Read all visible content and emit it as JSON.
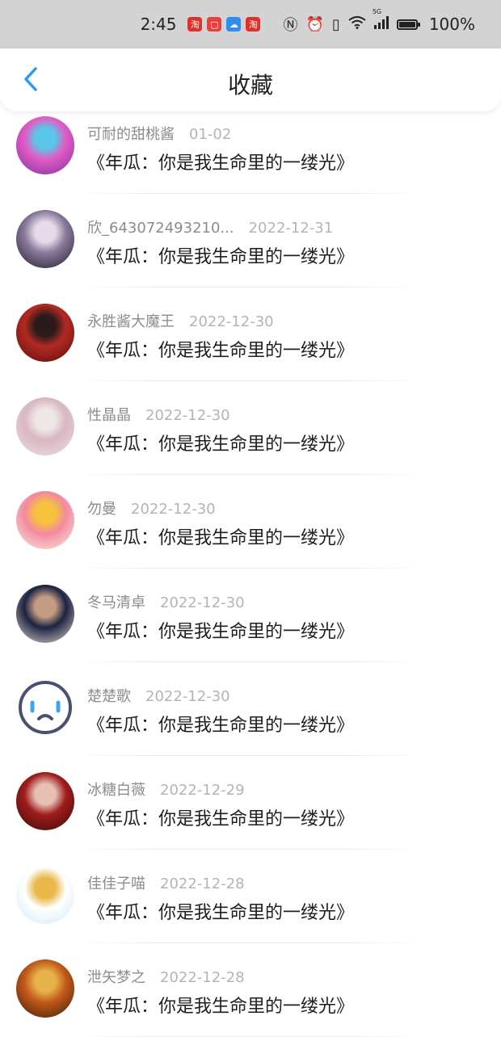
{
  "status_bar": {
    "time": "2:45",
    "battery": "100%",
    "signal_label": "5G",
    "app_icons": [
      {
        "name": "taobao-app-icon",
        "glyph": "淘",
        "color": "#e0302a"
      },
      {
        "name": "red-app-icon",
        "glyph": "▢",
        "color": "#e8403a"
      },
      {
        "name": "cloud-app-icon",
        "glyph": "☁",
        "color": "#2f8cf0"
      },
      {
        "name": "taobao-promo-app-icon",
        "glyph": "淘",
        "color": "#e0302a"
      }
    ]
  },
  "header": {
    "title": "收藏",
    "back_icon": "chevron-left-icon",
    "accent_color": "#2b9af3"
  },
  "items": [
    {
      "user": "可耐的甜桃酱",
      "date": "01-02",
      "title": "《年瓜：你是我生命里的一缕光》",
      "avatar": [
        "#7b2fa0",
        "#e35bc5",
        "#59c7e8"
      ]
    },
    {
      "user": "欣_643072493210...",
      "date": "2022-12-31",
      "title": "《年瓜：你是我生命里的一缕光》",
      "avatar": [
        "#1c1c28",
        "#8a7a9c",
        "#e5dcea"
      ]
    },
    {
      "user": "永胜酱大魔王",
      "date": "2022-12-30",
      "title": "《年瓜：你是我生命里的一缕光》",
      "avatar": [
        "#5a0d0d",
        "#b22a22",
        "#2a1b1b"
      ]
    },
    {
      "user": "性晶晶",
      "date": "2022-12-30",
      "title": "《年瓜：你是我生命里的一缕光》",
      "avatar": [
        "#f1dfe3",
        "#d7b7c2",
        "#efe6e6"
      ]
    },
    {
      "user": "勿曼",
      "date": "2022-12-30",
      "title": "《年瓜：你是我生命里的一缕光》",
      "avatar": [
        "#fbefe4",
        "#f28aa0",
        "#f6c23e"
      ]
    },
    {
      "user": "冬马清卓",
      "date": "2022-12-30",
      "title": "《年瓜：你是我生命里的一缕光》",
      "avatar": [
        "#e9ddd4",
        "#1c2340",
        "#c49c84"
      ]
    },
    {
      "user": "楚楚歌",
      "date": "2022-12-30",
      "title": "《年瓜：你是我生命里的一缕光》",
      "avatar": [
        "#ffffff",
        "#4a5170",
        "#3fa5e8"
      ]
    },
    {
      "user": "冰糖白薇",
      "date": "2022-12-29",
      "title": "《年瓜：你是我生命里的一缕光》",
      "avatar": [
        "#3a0a0a",
        "#9e1c1c",
        "#e7c0b4"
      ]
    },
    {
      "user": "佳佳子喵",
      "date": "2022-12-28",
      "title": "《年瓜：你是我生命里的一缕光》",
      "avatar": [
        "#cfeaf7",
        "#ffffff",
        "#e9b84a"
      ]
    },
    {
      "user": "泄矢梦之",
      "date": "2022-12-28",
      "title": "《年瓜：你是我生命里的一缕光》",
      "avatar": [
        "#3a1a08",
        "#c25a1a",
        "#e8b24a"
      ]
    }
  ]
}
